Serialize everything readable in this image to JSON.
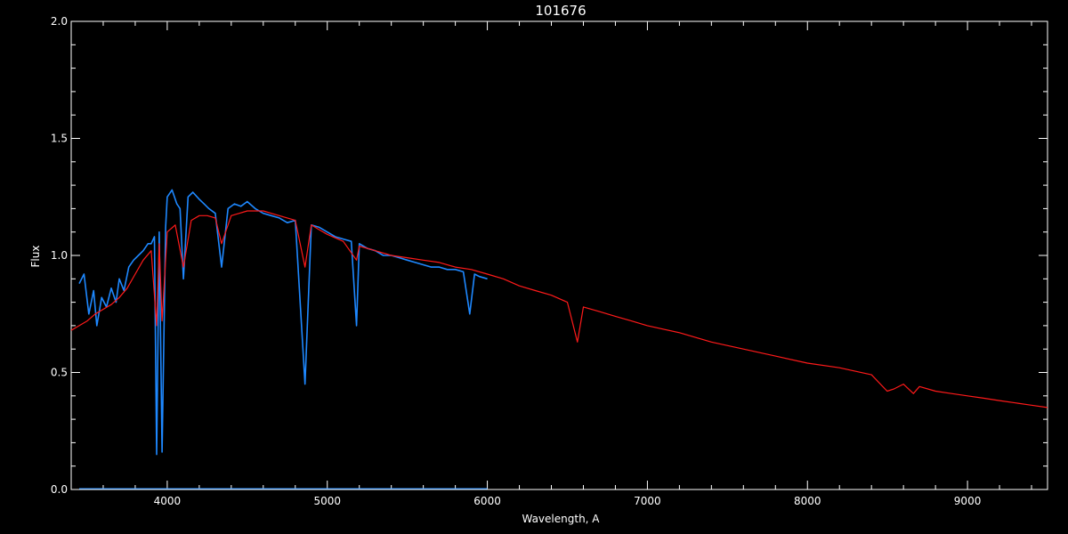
{
  "chart_data": {
    "type": "line",
    "title": "101676",
    "xlabel": "Wavelength, A",
    "ylabel": "Flux",
    "xlim": [
      3400,
      9500
    ],
    "ylim": [
      0.0,
      2.0
    ],
    "x_ticks": [
      4000,
      5000,
      6000,
      7000,
      8000,
      9000
    ],
    "x_tick_labels": [
      "4000",
      "5000",
      "6000",
      "7000",
      "8000",
      "9000"
    ],
    "y_ticks": [
      0.0,
      0.5,
      1.0,
      1.5,
      2.0
    ],
    "y_tick_labels": [
      "0.0",
      "0.5",
      "1.0",
      "1.5",
      "2.0"
    ],
    "grid": false,
    "background": "#000000",
    "axis_color": "#ffffff",
    "series": [
      {
        "color": "#1e88ff",
        "x": [
          3450,
          3480,
          3510,
          3540,
          3560,
          3590,
          3620,
          3650,
          3680,
          3700,
          3730,
          3760,
          3790,
          3820,
          3850,
          3880,
          3900,
          3920,
          3934,
          3950,
          3968,
          3990,
          4000,
          4030,
          4060,
          4080,
          4101,
          4130,
          4160,
          4200,
          4230,
          4260,
          4300,
          4340,
          4380,
          4420,
          4460,
          4500,
          4550,
          4600,
          4650,
          4700,
          4750,
          4800,
          4861,
          4900,
          4950,
          5000,
          5050,
          5100,
          5150,
          5183,
          5200,
          5250,
          5300,
          5350,
          5400,
          5450,
          5500,
          5550,
          5600,
          5650,
          5700,
          5750,
          5800,
          5850,
          5890,
          5920,
          5950,
          6000
        ],
        "y": [
          0.88,
          0.92,
          0.75,
          0.85,
          0.7,
          0.82,
          0.78,
          0.86,
          0.8,
          0.9,
          0.85,
          0.95,
          0.98,
          1.0,
          1.02,
          1.05,
          1.05,
          1.08,
          0.15,
          1.1,
          0.16,
          1.12,
          1.25,
          1.28,
          1.22,
          1.2,
          0.9,
          1.25,
          1.27,
          1.24,
          1.22,
          1.2,
          1.18,
          0.95,
          1.2,
          1.22,
          1.21,
          1.23,
          1.2,
          1.18,
          1.17,
          1.16,
          1.14,
          1.15,
          0.45,
          1.13,
          1.12,
          1.1,
          1.08,
          1.07,
          1.06,
          0.7,
          1.05,
          1.03,
          1.02,
          1.0,
          1.0,
          0.99,
          0.98,
          0.97,
          0.96,
          0.95,
          0.95,
          0.94,
          0.94,
          0.93,
          0.75,
          0.92,
          0.91,
          0.9
        ]
      },
      {
        "color": "#ff1a1a",
        "x": [
          3400,
          3450,
          3500,
          3550,
          3600,
          3650,
          3700,
          3750,
          3800,
          3850,
          3900,
          3934,
          3950,
          3968,
          4000,
          4050,
          4101,
          4150,
          4200,
          4250,
          4300,
          4340,
          4400,
          4450,
          4500,
          4550,
          4600,
          4650,
          4700,
          4750,
          4800,
          4861,
          4900,
          4950,
          5000,
          5100,
          5183,
          5200,
          5300,
          5400,
          5500,
          5600,
          5700,
          5800,
          5900,
          6000,
          6100,
          6200,
          6300,
          6400,
          6500,
          6563,
          6600,
          6700,
          6800,
          6900,
          7000,
          7200,
          7400,
          7600,
          7800,
          8000,
          8200,
          8400,
          8498,
          8542,
          8600,
          8662,
          8700,
          8800,
          8900,
          9000,
          9100,
          9200,
          9300,
          9400,
          9500
        ],
        "y": [
          0.68,
          0.7,
          0.72,
          0.75,
          0.77,
          0.79,
          0.82,
          0.86,
          0.92,
          0.98,
          1.02,
          0.7,
          1.05,
          0.72,
          1.1,
          1.13,
          0.95,
          1.15,
          1.17,
          1.17,
          1.16,
          1.05,
          1.17,
          1.18,
          1.19,
          1.19,
          1.19,
          1.18,
          1.17,
          1.16,
          1.15,
          0.95,
          1.13,
          1.11,
          1.09,
          1.06,
          0.98,
          1.04,
          1.02,
          1.0,
          0.99,
          0.98,
          0.97,
          0.95,
          0.94,
          0.92,
          0.9,
          0.87,
          0.85,
          0.83,
          0.8,
          0.63,
          0.78,
          0.76,
          0.74,
          0.72,
          0.7,
          0.67,
          0.63,
          0.6,
          0.57,
          0.54,
          0.52,
          0.49,
          0.42,
          0.43,
          0.45,
          0.41,
          0.44,
          0.42,
          0.41,
          0.4,
          0.39,
          0.38,
          0.37,
          0.36,
          0.35
        ]
      }
    ]
  }
}
